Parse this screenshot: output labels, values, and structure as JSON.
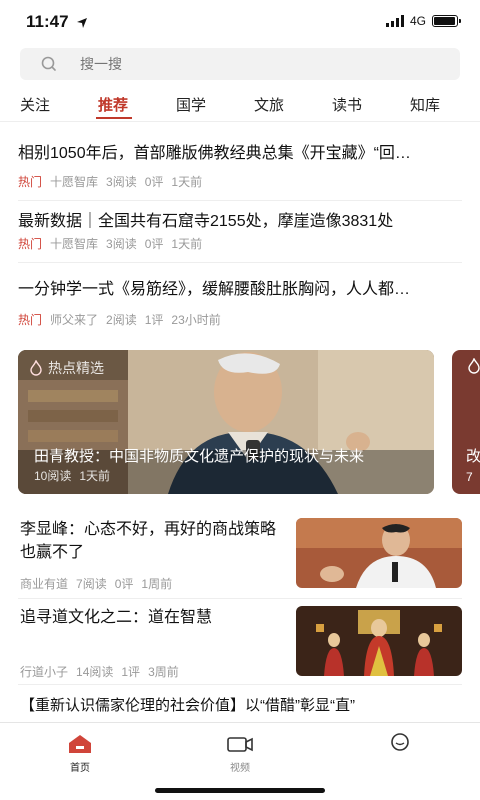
{
  "status_bar": {
    "time": "11:47",
    "network": "4G",
    "battery_level": 0.95
  },
  "search": {
    "placeholder": "搜一搜"
  },
  "tabs": [
    {
      "label": "关注"
    },
    {
      "label": "推荐",
      "active": true
    },
    {
      "label": "国学"
    },
    {
      "label": "文旅"
    },
    {
      "label": "读书"
    },
    {
      "label": "知库"
    }
  ],
  "articles": [
    {
      "title": "相别1050年后，首部雕版佛教经典总集《开宝藏》“回…",
      "tag": "热门",
      "source": "十愿智库",
      "reads": "3阅读",
      "comments": "0评",
      "time": "1天前"
    },
    {
      "title": "最新数据｜全国共有石窟寺2155处，摩崖造像3831处",
      "tag": "热门",
      "source": "十愿智库",
      "reads": "3阅读",
      "comments": "0评",
      "time": "1天前"
    },
    {
      "title": "一分钟学一式《易筋经》，缓解腰酸肚胀胸闷，人人都…",
      "tag": "热门",
      "source": "师父来了",
      "reads": "2阅读",
      "comments": "1评",
      "time": "23小时前"
    }
  ],
  "carousel": {
    "tag": "热点精选",
    "title": "田青教授：中国非物质文化遗产保护的现状与未来",
    "reads": "10阅读",
    "time": "1天前",
    "next_title": "改",
    "next_meta": "7"
  },
  "news_rows": [
    {
      "title": "李显峰：心态不好，再好的商战策略也赢不了",
      "source": "商业有道",
      "reads": "7阅读",
      "comments": "0评",
      "time": "1周前"
    },
    {
      "title": "追寻道文化之二：道在智慧",
      "source": "行道小子",
      "reads": "14阅读",
      "comments": "1评",
      "time": "3周前"
    }
  ],
  "last_title": "【重新认识儒家伦理的社会价值】以“借醋”彰显“直”",
  "bottom_nav": [
    {
      "label": "首页",
      "icon": "home-icon",
      "active": true
    },
    {
      "label": "视频",
      "icon": "video-icon"
    },
    {
      "label": "",
      "icon": "profile-icon"
    }
  ],
  "colors": {
    "accent": "#c0392b",
    "hot": "#d0453a"
  }
}
